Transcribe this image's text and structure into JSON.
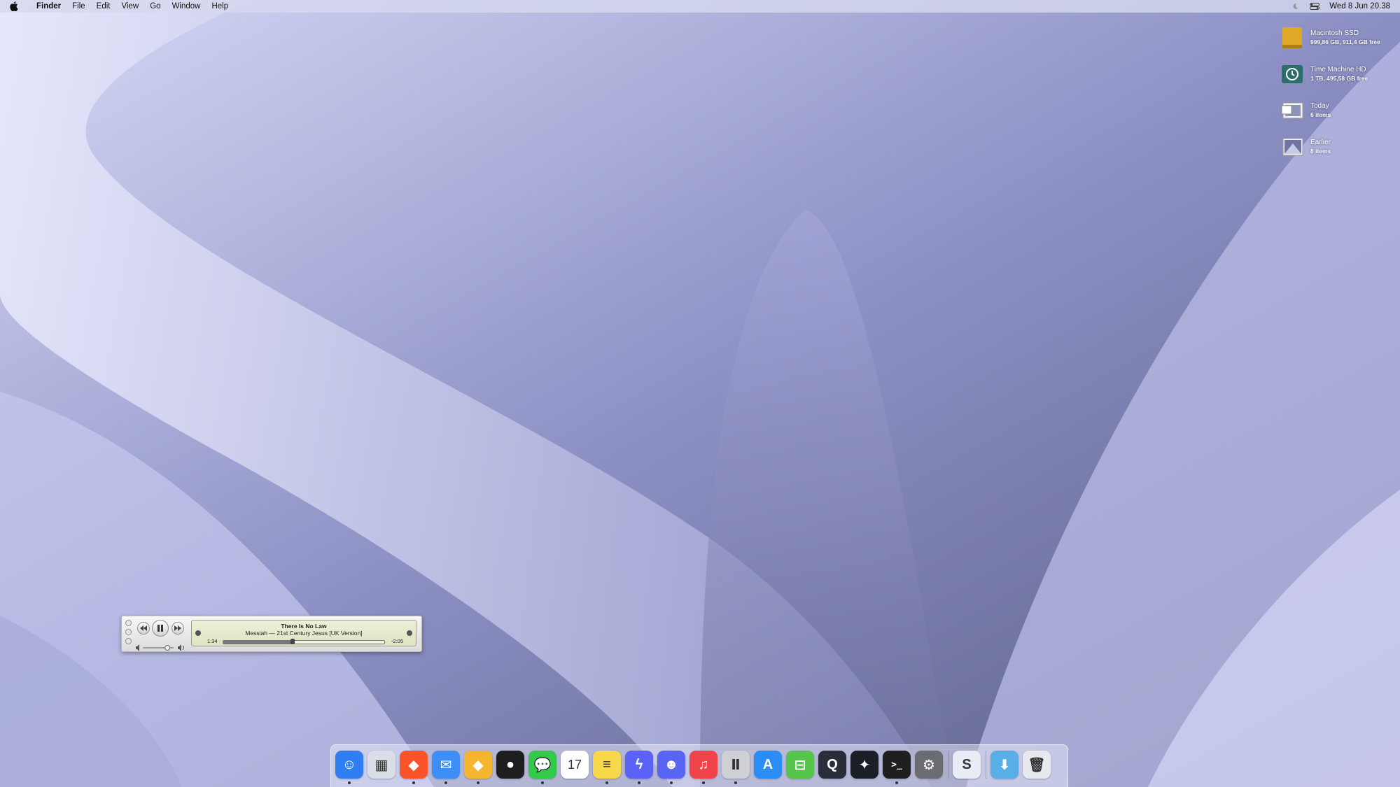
{
  "menubar": {
    "app_name": "Finder",
    "items": [
      "File",
      "Edit",
      "View",
      "Go",
      "Window",
      "Help"
    ],
    "clock": "Wed 8 Jun  20.38"
  },
  "desktop": {
    "items": [
      {
        "label": "Macintosh SSD",
        "sub": "999,86 GB, 911,4 GB free",
        "icon": "drive-icon"
      },
      {
        "label": "Time Machine HD",
        "sub": "1 TB, 495,58 GB free",
        "icon": "time-machine-icon"
      },
      {
        "label": "Today",
        "sub": "6 items",
        "icon": "stack-icon"
      },
      {
        "label": "Earlier",
        "sub": "8 items",
        "icon": "stack-icon"
      }
    ]
  },
  "player": {
    "title": "There Is No Law",
    "subtitle": "Messiah — 21st Century Jesus [UK Version]",
    "elapsed": "1:34",
    "remaining": "-2:05",
    "progress": 0.43,
    "volume": 0.8
  },
  "dock": {
    "apps": [
      {
        "name": "finder",
        "color": "#2f7ff2",
        "glyph": "☺",
        "running": true
      },
      {
        "name": "launchpad",
        "color": "#d9dde6",
        "glyph": "▦",
        "running": false
      },
      {
        "name": "brave",
        "color": "#fb542b",
        "glyph": "◆",
        "running": true
      },
      {
        "name": "mail",
        "color": "#3d8ff5",
        "glyph": "✉",
        "running": true
      },
      {
        "name": "sketch",
        "color": "#f6b530",
        "glyph": "◆",
        "running": true
      },
      {
        "name": "figma",
        "color": "#1e1e1e",
        "glyph": "●",
        "running": false
      },
      {
        "name": "messages",
        "color": "#33c94a",
        "glyph": "💬",
        "running": true
      },
      {
        "name": "calendar",
        "color": "#ffffff",
        "glyph": "17",
        "running": false
      },
      {
        "name": "notes",
        "color": "#f7d84a",
        "glyph": "≡",
        "running": true
      },
      {
        "name": "messenger",
        "color": "#5a62f7",
        "glyph": "ϟ",
        "running": true
      },
      {
        "name": "discord",
        "color": "#5865f2",
        "glyph": "☻",
        "running": true
      },
      {
        "name": "music",
        "color": "#f0434a",
        "glyph": "♫",
        "running": true
      },
      {
        "name": "pause",
        "color": "#cfcfd6",
        "glyph": "Ⅱ",
        "running": true
      },
      {
        "name": "app-store",
        "color": "#2c8cf6",
        "glyph": "A",
        "running": false
      },
      {
        "name": "drop",
        "color": "#55c54b",
        "glyph": "⊟",
        "running": false
      },
      {
        "name": "quicktime",
        "color": "#2a2d3a",
        "glyph": "Q",
        "running": false
      },
      {
        "name": "beta-app",
        "color": "#1a1f28",
        "glyph": "✦",
        "running": false
      },
      {
        "name": "terminal",
        "color": "#1f1f1f",
        "glyph": ">_",
        "running": true
      },
      {
        "name": "system-preferences",
        "color": "#6b6b72",
        "glyph": "⚙",
        "running": false
      },
      {
        "name": "shazam",
        "color": "#e7ecf5",
        "glyph": "S",
        "running": false
      },
      {
        "name": "downloads",
        "color": "#59aee8",
        "glyph": "⬇",
        "running": false
      },
      {
        "name": "trash",
        "color": "#e8e9ee",
        "glyph": "🗑",
        "running": false
      }
    ]
  }
}
